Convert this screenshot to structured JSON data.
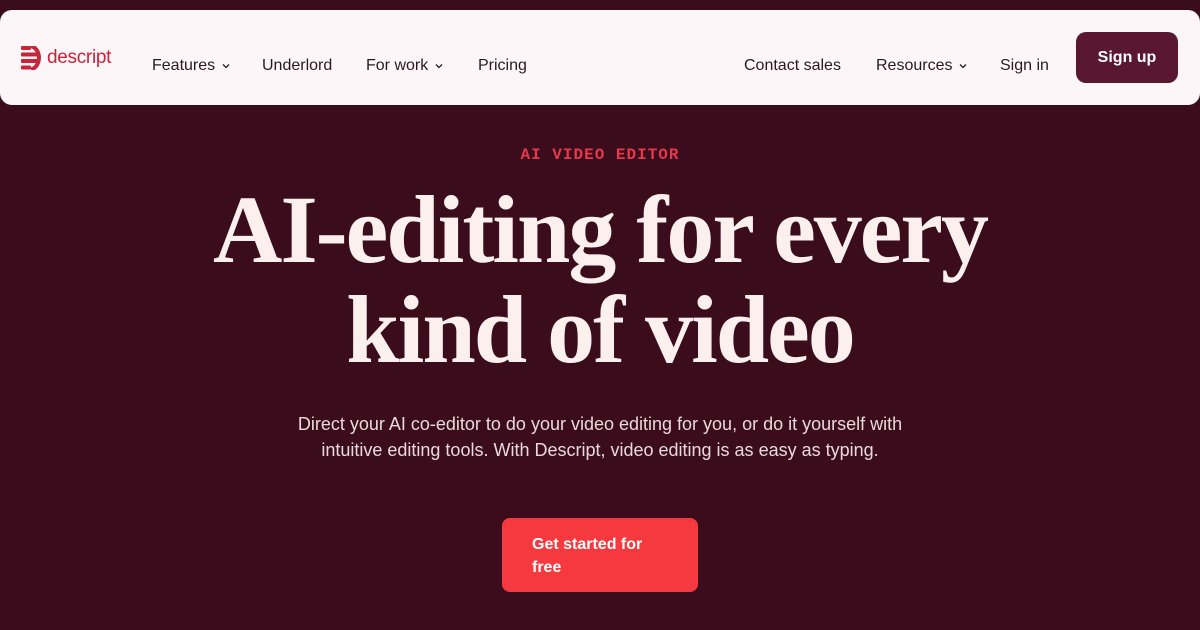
{
  "nav": {
    "logo_text": "descript",
    "items": {
      "features": "Features",
      "underlord": "Underlord",
      "for_work": "For work",
      "pricing": "Pricing",
      "contact_sales": "Contact sales",
      "resources": "Resources",
      "sign_in": "Sign in"
    },
    "signup_label": "Sign up"
  },
  "hero": {
    "eyebrow": "AI VIDEO EDITOR",
    "headline_line1": "AI-editing for every",
    "headline_line2": "kind of video",
    "subtext": "Direct your AI co-editor to do your video editing for you, or do it yourself with intuitive editing tools. With Descript, video editing is as easy as typing.",
    "cta_label": "Get started for free"
  },
  "colors": {
    "background": "#3a0c1c",
    "nav_background": "#fdf6f8",
    "brand_red": "#c8243a",
    "cta": "#f5393f",
    "signup": "#5a1830"
  },
  "icons": {
    "logo": "descript-logo-icon",
    "dropdown": "chevron-down-icon"
  }
}
